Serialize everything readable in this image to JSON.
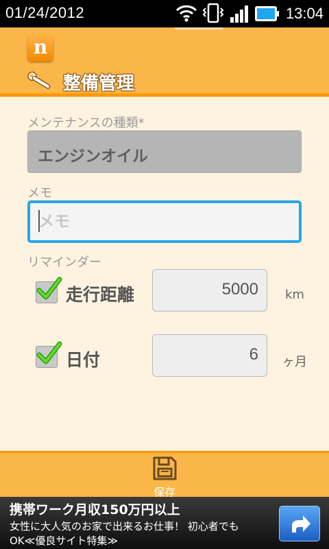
{
  "status_bar": {
    "date": "01/24/2012",
    "time": "13:04"
  },
  "app": {
    "logo_letter": "n",
    "title": "整備管理"
  },
  "form": {
    "type_label": "メンテナンスの種類*",
    "type_value": "エンジンオイル",
    "memo_label": "メモ",
    "memo_placeholder": "メモ",
    "reminder_label": "リマインダー",
    "mileage": {
      "label": "走行距離",
      "checked": true,
      "value": "5000",
      "unit": "km"
    },
    "date": {
      "label": "日付",
      "checked": true,
      "value": "6",
      "unit": "ヶ月"
    }
  },
  "bottom_bar": {
    "save_label": "保存"
  },
  "ad": {
    "line1": "携帯ワーク月収150万円以上",
    "line2": "女性に大人気のお家で出来るお仕事！ 初心者でも",
    "line3": "OK≪優良サイト特集≫"
  },
  "colors": {
    "accent": "#fbb64a",
    "accent_dark": "#ff9900",
    "focus": "#27a6e8",
    "check": "#44c21c"
  }
}
